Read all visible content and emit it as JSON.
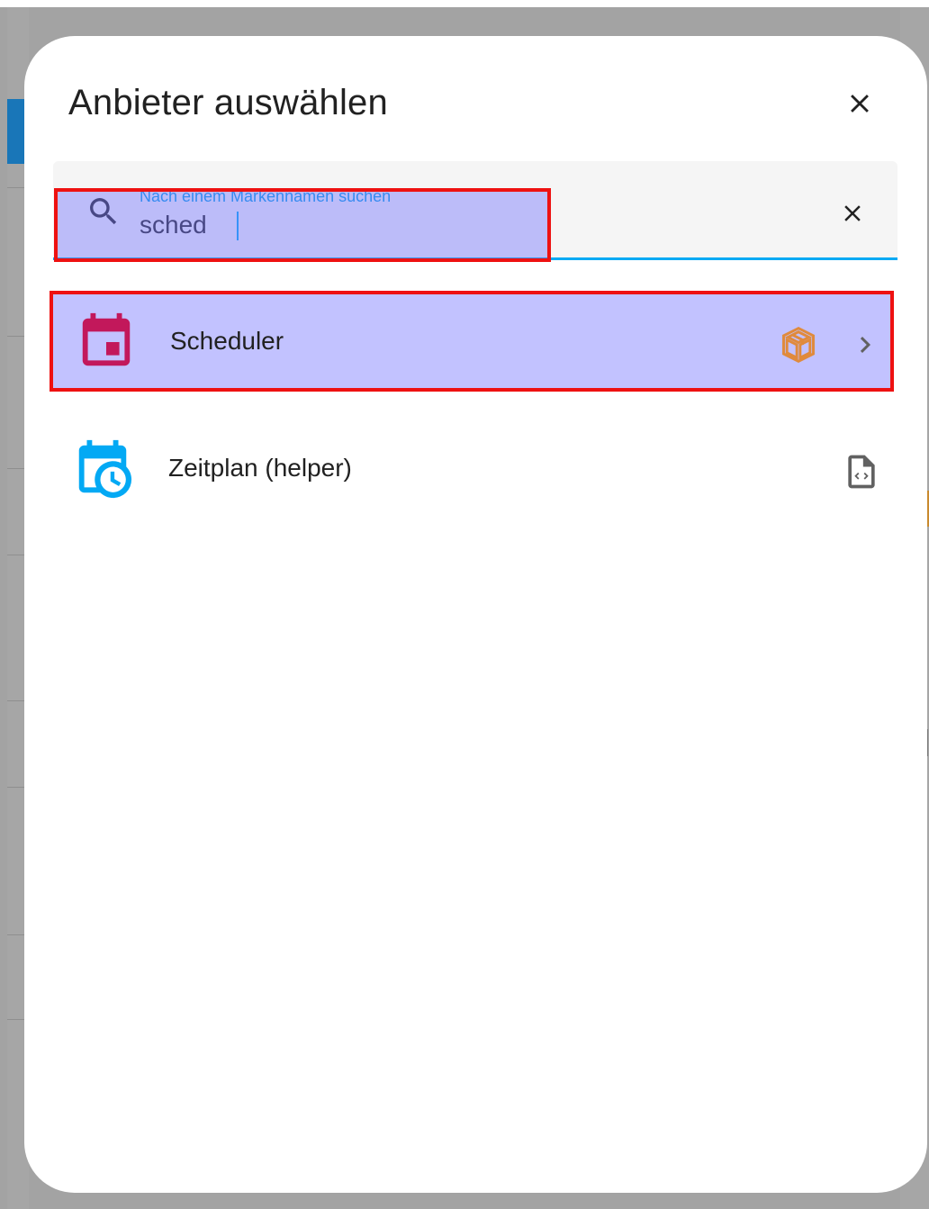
{
  "dialog": {
    "title": "Anbieter auswählen",
    "close_icon": "close-icon"
  },
  "search": {
    "label": "Nach einem Markennamen suchen",
    "value": "sched",
    "icon": "search-icon",
    "clear_icon": "clear-icon"
  },
  "results": [
    {
      "label": "Scheduler",
      "icon": "calendar-icon",
      "icon_color": "#c2185b",
      "badge_icon": "package-icon",
      "badge_color": "#e08a3c",
      "trailing_icon": "chevron-right-icon",
      "highlighted": true
    },
    {
      "label": "Zeitplan (helper)",
      "icon": "calendar-clock-icon",
      "icon_color": "#03a9f4",
      "badge_icon": "code-file-icon",
      "badge_color": "#616161",
      "highlighted": false
    }
  ],
  "colors": {
    "accent": "#03a9f4",
    "highlight_border": "#ee1111",
    "highlight_fill": "rgba(120,120,255,0.45)"
  }
}
